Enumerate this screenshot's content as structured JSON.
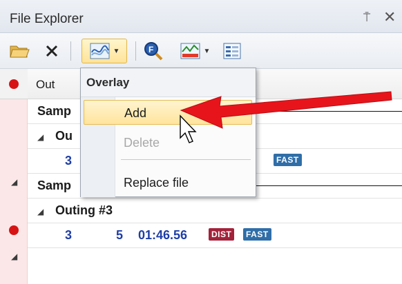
{
  "window": {
    "title": "File Explorer",
    "pin_glyph": "⍑",
    "close_glyph": "✕"
  },
  "toolbar": {
    "open_icon": "folder-open-icon",
    "delete_icon": "close-icon",
    "overlay_icon": "overlay-chart-icon",
    "find_icon": "find-magnifier-icon",
    "chart_icon": "color-chart-icon",
    "properties_icon": "properties-icon"
  },
  "grid": {
    "header": {
      "out": "Out"
    },
    "rows": [
      {
        "kind": "group",
        "label": "Samp"
      },
      {
        "kind": "subgroup",
        "label": "Ou"
      },
      {
        "kind": "data",
        "out": "3",
        "badge": "FAST"
      },
      {
        "kind": "group",
        "label": "Samp"
      },
      {
        "kind": "subgroup",
        "label": "Outing #3"
      },
      {
        "kind": "data",
        "out": "3",
        "lap": "5",
        "time": "01:46.56",
        "badge1": "DIST",
        "badge2": "FAST"
      }
    ]
  },
  "menu": {
    "header": "Overlay",
    "items": [
      {
        "label": "Add",
        "state": "active"
      },
      {
        "label": "Delete",
        "state": "disabled"
      },
      {
        "label": "Replace file",
        "state": "normal"
      }
    ]
  },
  "colors": {
    "accent_arrow": "#e8141c",
    "badge_dist": "#a3223b",
    "badge_fast": "#2f6ea8",
    "record_dot": "#d61414"
  }
}
